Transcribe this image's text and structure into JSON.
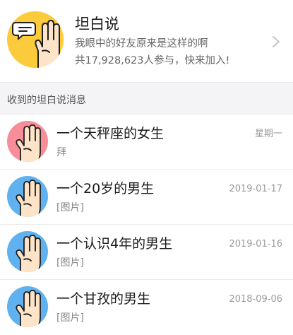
{
  "header": {
    "title": "坦白说",
    "subtitle": "我眼中的好友原来是这样的啊",
    "count_text": "共17,928,623人参与，快来加入!",
    "avatar_icon": "hand-speech-bubble-icon",
    "avatar_color": "#fccb3b"
  },
  "section": {
    "label": "收到的坦白说消息"
  },
  "messages": [
    {
      "title": "一个天秤座的女生",
      "preview": "拜",
      "time": "星期一",
      "avatar_icon": "hand-icon",
      "avatar_color": "#f78d98"
    },
    {
      "title": "一个20岁的男生",
      "preview": "[图片]",
      "time": "2019-01-17",
      "avatar_icon": "hand-icon",
      "avatar_color": "#5fb2ef"
    },
    {
      "title": "一个认识4年的男生",
      "preview": "[图片]",
      "time": "2019-01-16",
      "avatar_icon": "hand-icon",
      "avatar_color": "#5fb2ef"
    },
    {
      "title": "一个甘孜的男生",
      "preview": "[图片]",
      "time": "2018-09-06",
      "avatar_icon": "hand-icon",
      "avatar_color": "#5fb2ef"
    }
  ]
}
